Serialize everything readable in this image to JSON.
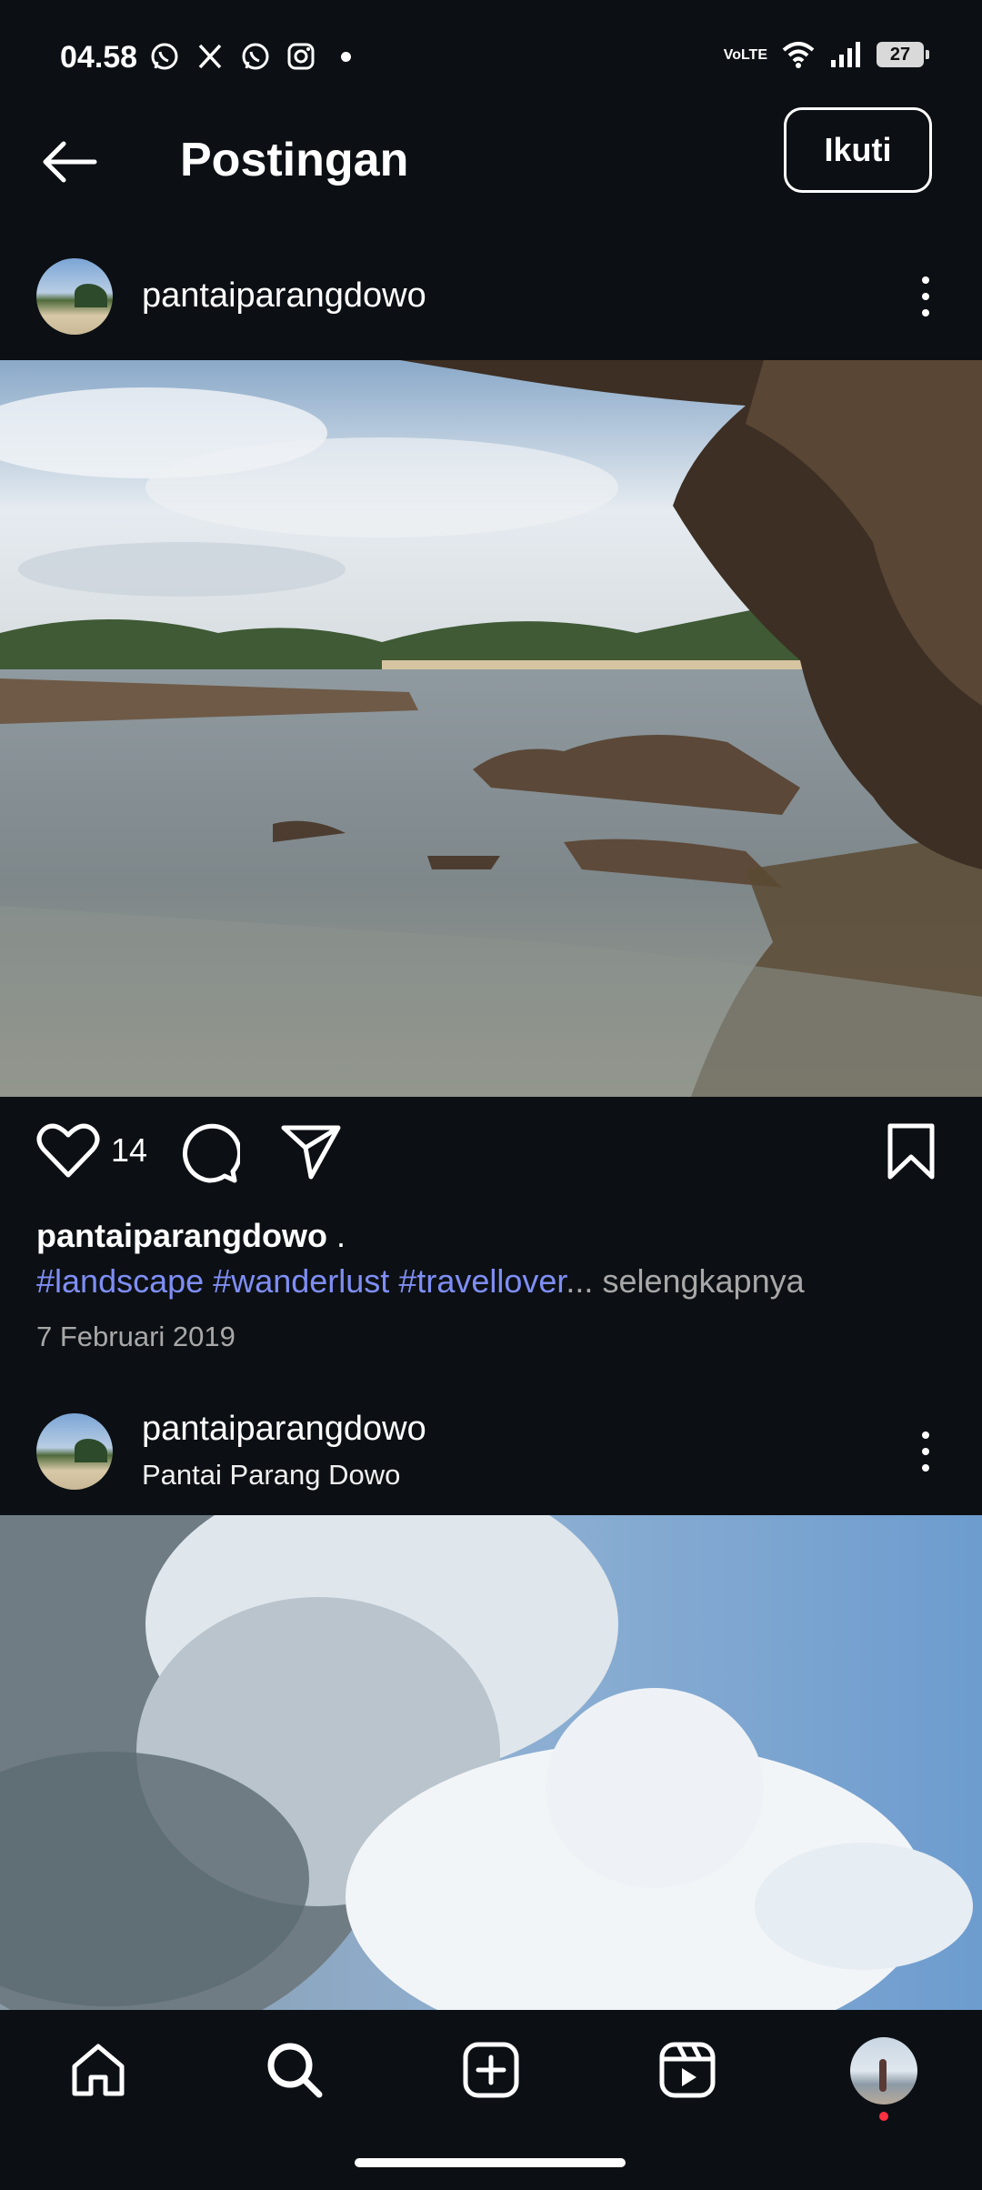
{
  "status_bar": {
    "time": "04.58",
    "notification_icons": [
      "whatsapp-icon",
      "x-icon",
      "whatsapp-icon",
      "instagram-icon"
    ],
    "network_label": "VoLTE",
    "battery_level": "27"
  },
  "header": {
    "title": "Postingan",
    "follow_label": "Ikuti"
  },
  "posts": [
    {
      "username": "pantaiparangdowo",
      "location": "",
      "like_count": "14",
      "caption_user": "pantaiparangdowo",
      "caption_text": " .",
      "hashtags": [
        "#landscape",
        "#wanderlust",
        "#travellover"
      ],
      "ellipsis": "...",
      "more_label": "selengkapnya",
      "date": "7 Februari 2019"
    },
    {
      "username": "pantaiparangdowo",
      "location": "Pantai Parang Dowo"
    }
  ],
  "bottom_nav": [
    "home-icon",
    "search-icon",
    "create-icon",
    "reels-icon",
    "profile-avatar"
  ],
  "colors": {
    "background": "#0c1014",
    "hashtag": "#7f8ef5",
    "secondary_text": "#a8a8a8",
    "notification_dot": "#ff3040"
  }
}
